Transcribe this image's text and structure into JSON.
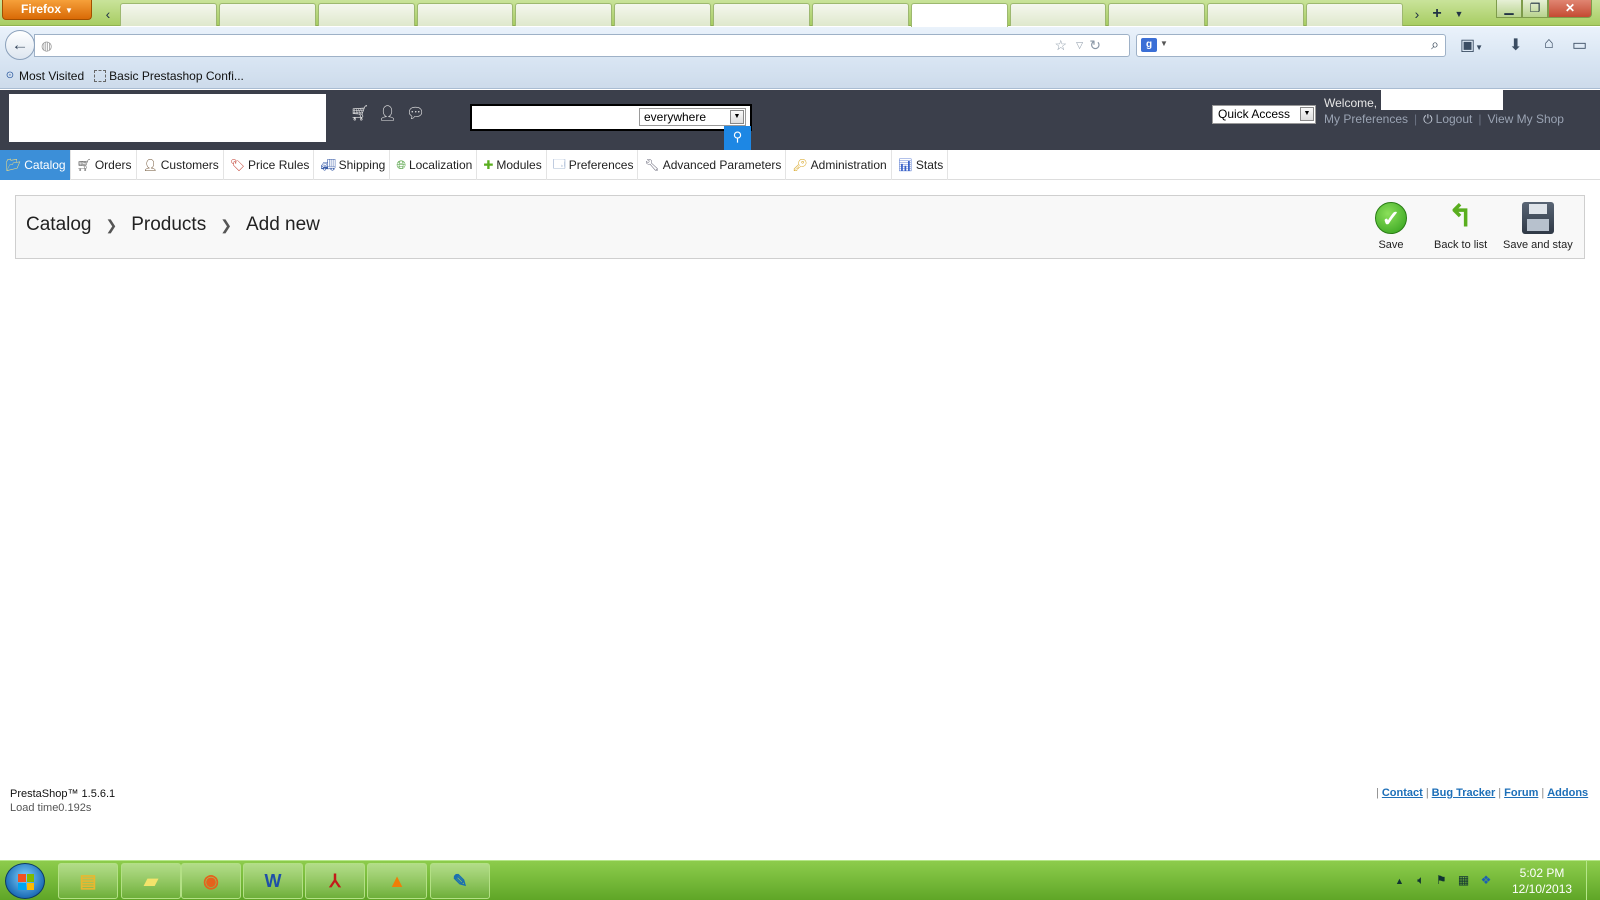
{
  "browser": {
    "menu_label": "Firefox",
    "tab_count": 13,
    "active_tab_index": 8,
    "bookmarks": [
      {
        "label": "Most Visited",
        "icon": "most-visited-icon"
      },
      {
        "label": "Basic Prestashop Confi...",
        "icon": "page-icon"
      }
    ]
  },
  "header": {
    "search_scope": "everywhere",
    "quick_access": "Quick Access",
    "welcome": "Welcome,",
    "my_preferences": "My Preferences",
    "logout": "Logout",
    "view_shop": "View My Shop"
  },
  "menu": {
    "items": [
      {
        "label": "Catalog",
        "icon": "folder-icon",
        "active": true
      },
      {
        "label": "Orders",
        "icon": "cart-icon"
      },
      {
        "label": "Customers",
        "icon": "user-icon"
      },
      {
        "label": "Price Rules",
        "icon": "price-tag-icon"
      },
      {
        "label": "Shipping",
        "icon": "truck-icon"
      },
      {
        "label": "Localization",
        "icon": "globe-icon"
      },
      {
        "label": "Modules",
        "icon": "puzzle-icon"
      },
      {
        "label": "Preferences",
        "icon": "preferences-icon"
      },
      {
        "label": "Advanced Parameters",
        "icon": "wrench-icon"
      },
      {
        "label": "Administration",
        "icon": "key-icon"
      },
      {
        "label": "Stats",
        "icon": "bar-chart-icon"
      }
    ]
  },
  "breadcrumb": {
    "items": [
      "Catalog",
      "Products",
      "Add new"
    ]
  },
  "toolbar": {
    "save": "Save",
    "back": "Back to list",
    "save_stay": "Save and stay"
  },
  "footer": {
    "version": "PrestaShop™ 1.5.6.1",
    "load_time": "Load time0.192s",
    "links": [
      "Contact",
      "Bug Tracker",
      "Forum",
      "Addons"
    ]
  },
  "taskbar": {
    "time": "5:02 PM",
    "date": "12/10/2013",
    "apps": [
      {
        "icon": "file-explorer-icon",
        "glyph": "▤",
        "color": "#e8b730"
      },
      {
        "icon": "sticky-notes-icon",
        "glyph": "▰",
        "color": "#f3e36b"
      },
      {
        "icon": "firefox-icon",
        "glyph": "◉",
        "color": "#e5621c"
      },
      {
        "icon": "word-icon",
        "glyph": "W",
        "color": "#1f4fa8"
      },
      {
        "icon": "acrobat-icon",
        "glyph": "⅄",
        "color": "#c31a1a"
      },
      {
        "icon": "vlc-icon",
        "glyph": "▲",
        "color": "#f07d07"
      },
      {
        "icon": "feather-app-icon",
        "glyph": "✎",
        "color": "#1a6fb0"
      }
    ]
  },
  "colors": {
    "menu_active": "#3c8fd8",
    "header_bg": "#3b3f4b",
    "search_button": "#1d87e4",
    "link": "#1d6fb8"
  }
}
